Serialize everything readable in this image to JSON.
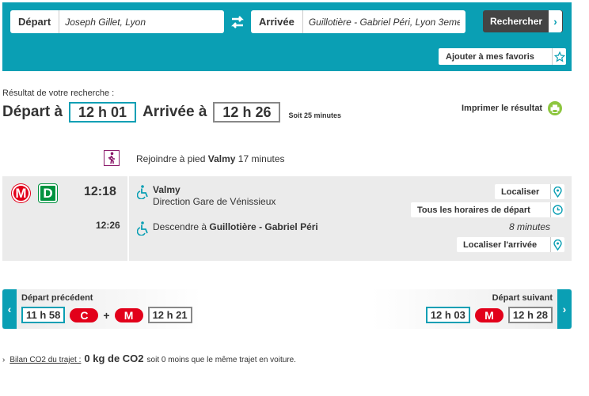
{
  "search": {
    "depart_label": "Départ",
    "depart_value": "Joseph Gillet, Lyon",
    "arrivee_label": "Arrivée",
    "arrivee_value": "Guillotière - Gabriel Péri, Lyon 3eme",
    "search_button": "Rechercher",
    "favorites_button": "Ajouter à mes favoris",
    "colors": {
      "bar": "#0a9fb4",
      "button": "#444444"
    }
  },
  "result": {
    "caption": "Résultat de votre recherche :",
    "depart_prefix": "Départ à",
    "depart_time": "12 h 01",
    "arrivee_prefix": "Arrivée à",
    "arrivee_time": "12 h 26",
    "duration": "Soit 25 minutes",
    "print_label": "Imprimer le résultat"
  },
  "walk": {
    "icon": "pedestrian-icon",
    "prefix": "Rejoindre à pied",
    "destination": "Valmy",
    "duration": "17 minutes"
  },
  "journey": {
    "lines": [
      {
        "code": "M",
        "color": "#e2001a"
      },
      {
        "code": "D",
        "color": "#00923f"
      }
    ],
    "departure_time": "12:18",
    "arrival_time": "12:26",
    "stop": "Valmy",
    "direction": "Direction Gare de Vénissieux",
    "descend_prefix": "Descendre à",
    "descend_stop": "Guillotière - Gabriel Péri",
    "ride_duration": "8 minutes",
    "localiser_button": "Localiser",
    "horaires_button": "Tous les horaires de départ",
    "arrivee_button": "Localiser l'arrivée"
  },
  "navigation": {
    "previous_label": "Départ précédent",
    "previous_depart": "11 h 58",
    "previous_line_1": "C",
    "previous_plus": "+",
    "previous_line_2": "M",
    "previous_arrivee": "12 h 21",
    "next_label": "Départ suivant",
    "next_depart": "12 h 03",
    "next_line": "M",
    "next_arrivee": "12 h 28"
  },
  "footer": {
    "co2_link": "Bilan CO2 du trajet :",
    "co2_value": "0 kg de CO2",
    "co2_note": "soit 0 moins que le même trajet en voiture."
  }
}
